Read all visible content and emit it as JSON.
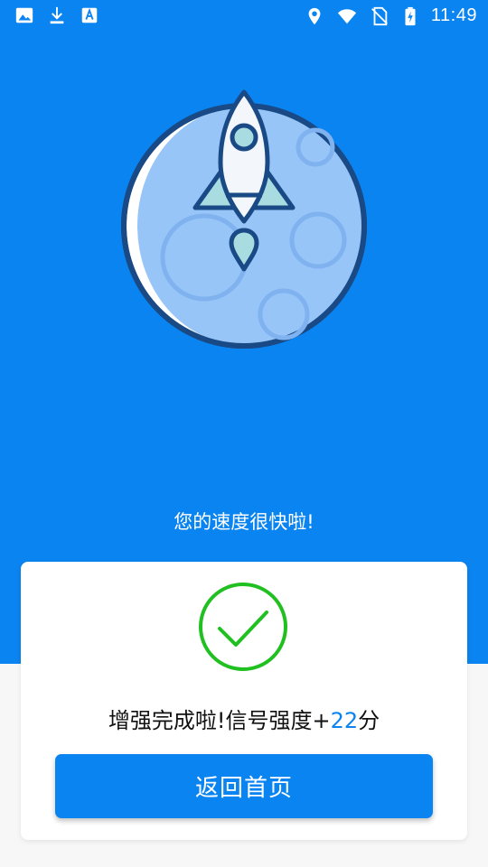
{
  "status_bar": {
    "time": "11:49",
    "left_icons": [
      "image-icon",
      "download-icon",
      "font-icon"
    ],
    "right_icons": [
      "location-icon",
      "wifi-icon",
      "no-sim-icon",
      "battery-charging-icon"
    ]
  },
  "hero": {
    "tagline": "您的速度很快啦!"
  },
  "result": {
    "message_prefix": "增强完成啦!信号强度+",
    "score": "22",
    "message_suffix": "分",
    "icon": "check-circle-icon",
    "button_label": "返回首页"
  },
  "colors": {
    "primary": "#0a84f0",
    "success": "#20c020",
    "card_bg": "#ffffff",
    "page_bg": "#f7f7f7"
  }
}
